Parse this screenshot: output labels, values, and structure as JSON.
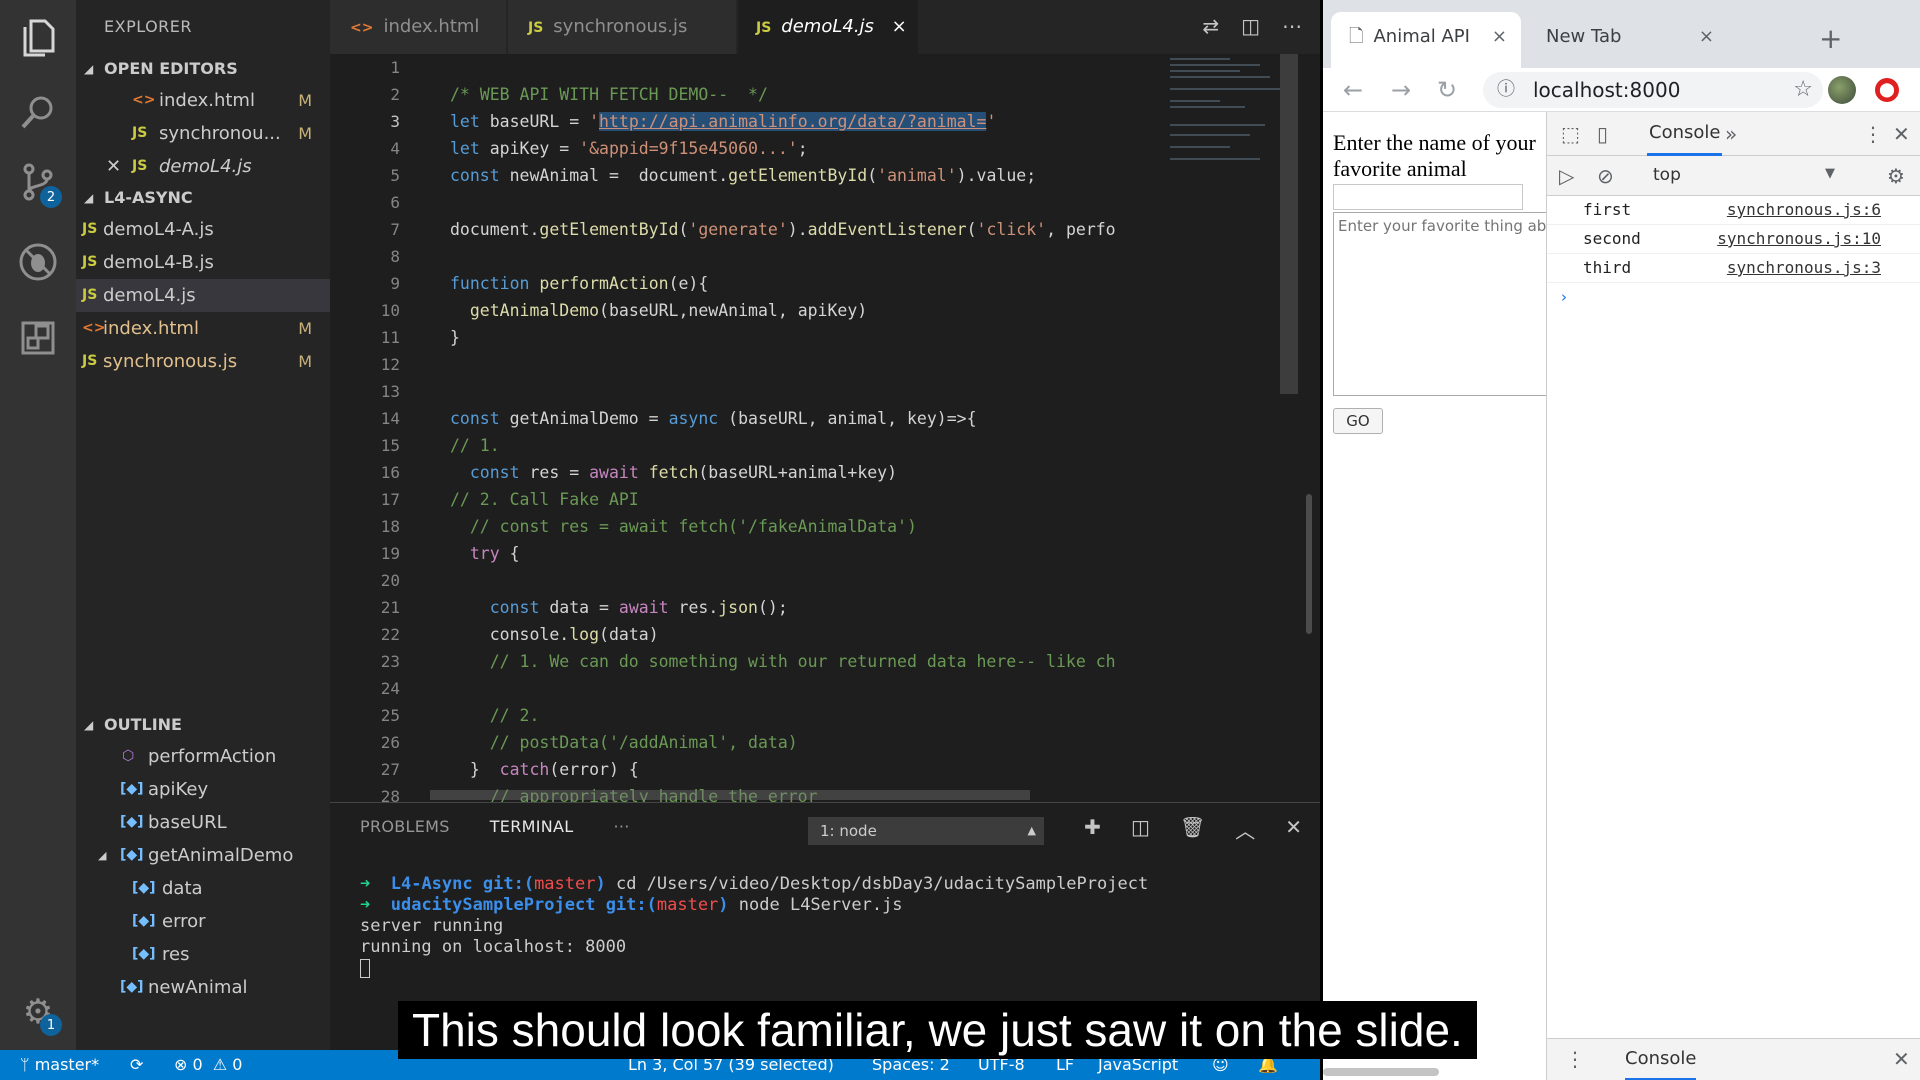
{
  "vscode": {
    "activity_badges": {
      "scm": "2",
      "settings": "1"
    },
    "sidebar": {
      "title": "EXPLORER",
      "open_editors_title": "OPEN EDITORS",
      "open_editors": [
        {
          "type": "html",
          "name": "index.html",
          "mark": "M"
        },
        {
          "type": "js",
          "name": "synchronou...",
          "mark": "M"
        },
        {
          "type": "js",
          "name": "demoL4.js",
          "mark": ""
        }
      ],
      "folder_title": "L4-ASYNC",
      "files": [
        {
          "type": "js",
          "name": "demoL4-A.js",
          "mark": ""
        },
        {
          "type": "js",
          "name": "demoL4-B.js",
          "mark": ""
        },
        {
          "type": "js",
          "name": "demoL4.js",
          "mark": ""
        },
        {
          "type": "html",
          "name": "index.html",
          "mark": "M"
        },
        {
          "type": "js",
          "name": "synchronous.js",
          "mark": "M"
        }
      ],
      "outline_title": "OUTLINE",
      "outline": [
        "performAction",
        "apiKey",
        "baseURL",
        "getAnimalDemo",
        "data",
        "error",
        "res",
        "newAnimal"
      ]
    },
    "tabs": [
      {
        "icon": "<>",
        "label": "index.html"
      },
      {
        "icon": "JS",
        "label": "synchronous.js"
      },
      {
        "icon": "JS",
        "label": "demoL4.js",
        "close": "×"
      }
    ],
    "panel": {
      "tabs": [
        "PROBLEMS",
        "TERMINAL",
        "···"
      ],
      "terminal_select": "1: node",
      "lines": [
        {
          "arrow": "➜",
          "dir": "L4-Async",
          "git": "git:(",
          "branch": "master",
          "git_end": ")",
          "cmd": " cd /Users/video/Desktop/dsbDay3/udacitySampleProject"
        },
        {
          "arrow": "➜",
          "dir": "udacitySampleProject",
          "git": "git:(",
          "branch": "master",
          "git_end": ")",
          "cmd": " node L4Server.js"
        },
        {
          "text": "server running"
        },
        {
          "text": "running on localhost: 8000"
        }
      ]
    },
    "status": {
      "branch": "master*",
      "errors": "0",
      "warnings": "0",
      "position": "Ln 3, Col 57 (39 selected)",
      "spaces": "Spaces: 2",
      "encoding": "UTF-8",
      "eol": "LF",
      "language": "JavaScript"
    }
  },
  "code_lines": [
    "",
    "/* WEB API WITH FETCH DEMO--  */",
    "let baseURL = 'http://api.animalinfo.org/data/?animal='",
    "let apiKey = '&appid=9f15e45060...';",
    "const newAnimal =  document.getElementById('animal').value;",
    "",
    "document.getElementById('generate').addEventListener('click', perfo",
    "",
    "function performAction(e){",
    "  getAnimalDemo(baseURL,newAnimal, apiKey)",
    "}",
    "",
    "",
    "const getAnimalDemo = async (baseURL, animal, key)=>{",
    "// 1.",
    "  const res = await fetch(baseURL+animal+key)",
    "// 2. Call Fake API",
    "  // const res = await fetch('/fakeAnimalData')",
    "  try {",
    "",
    "    const data = await res.json();",
    "    console.log(data)",
    "    // 1. We can do something with our returned data here-- like ch",
    "",
    "    // 2.",
    "    // postData('/addAnimal', data)",
    "  }  catch(error) {",
    "    // appropriately handle the error"
  ],
  "chrome": {
    "tabs": [
      {
        "label": "Animal API",
        "close": "×"
      },
      {
        "label": "New Tab",
        "close": "×"
      }
    ],
    "url": "localhost:8000",
    "page": {
      "label": "Enter the name of your favorite animal",
      "textarea_placeholder": "Enter your favorite thing ab",
      "button": "GO"
    },
    "devtools": {
      "tab": "Console",
      "context": "top",
      "logs": [
        {
          "msg": "first",
          "src": "synchronous.js:6"
        },
        {
          "msg": "second",
          "src": "synchronous.js:10"
        },
        {
          "msg": "third",
          "src": "synchronous.js:3"
        }
      ],
      "drawer_tab": "Console"
    }
  },
  "caption": "This should look familiar, we just saw it on the slide."
}
